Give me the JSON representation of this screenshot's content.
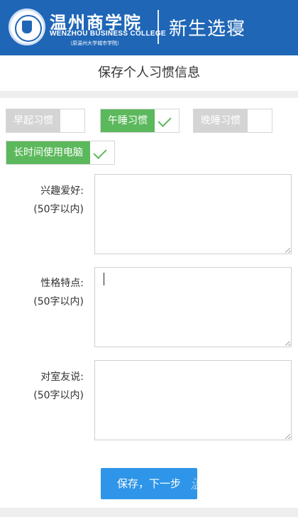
{
  "header": {
    "school_name_cn": "温州商学院",
    "school_name_en": "WENZHOU BUSINESS COLLEGE",
    "school_sub": "（原温州大学城市学院）",
    "system_title": "新生选寝",
    "colors": {
      "banner": "#1f66b6"
    }
  },
  "page": {
    "title": "保存个人习惯信息"
  },
  "habits": [
    {
      "label": "早起习惯",
      "checked": false
    },
    {
      "label": "午睡习惯",
      "checked": true
    },
    {
      "label": "晚睡习惯",
      "checked": false
    },
    {
      "label": "长时间使用电脑",
      "checked": true
    }
  ],
  "fields": [
    {
      "label": "兴趣爱好:",
      "hint": "(50字以内)",
      "value": ""
    },
    {
      "label": "性格特点:",
      "hint": "(50字以内)",
      "value": ""
    },
    {
      "label": "对室友说:",
      "hint": "(50字以内)",
      "value": ""
    }
  ],
  "submit": {
    "label": "保存，下一步",
    "watermark": "温州"
  },
  "colors": {
    "checked": "#5cb85c",
    "unchecked": "#d4d4d4",
    "submit": "#2f95e8"
  }
}
